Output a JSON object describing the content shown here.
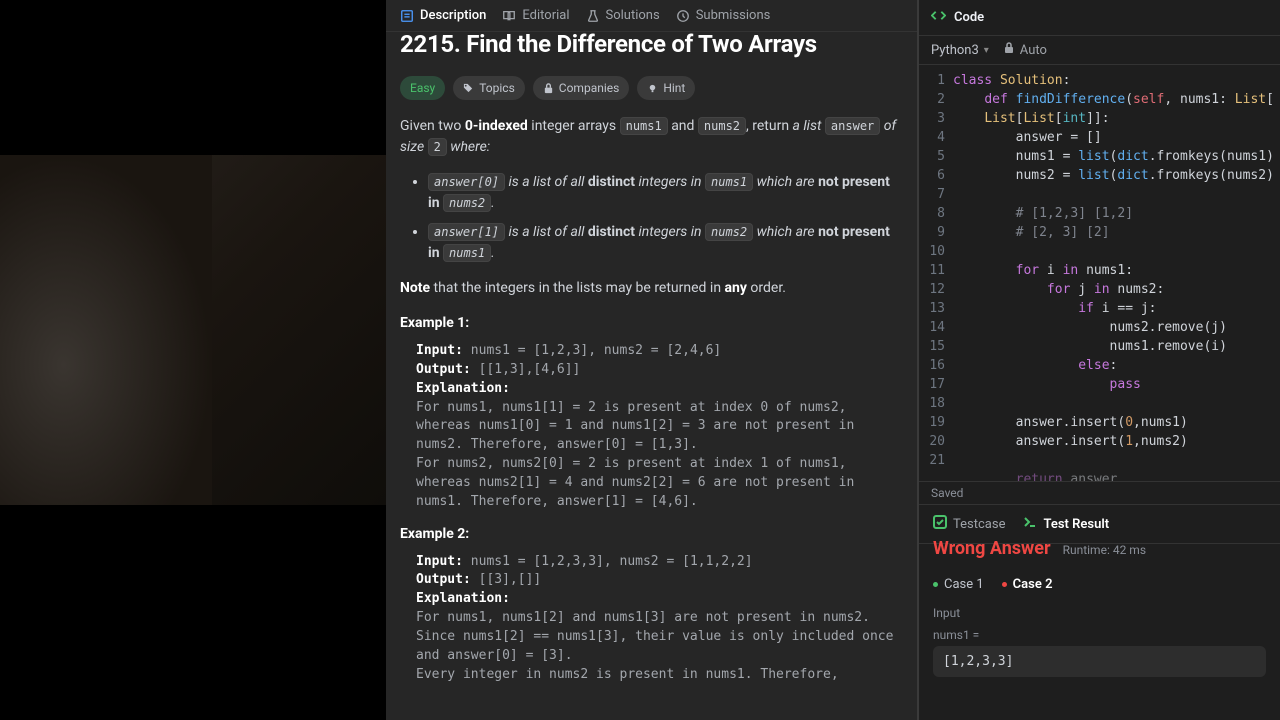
{
  "tabs": {
    "description": "Description",
    "editorial": "Editorial",
    "solutions": "Solutions",
    "submissions": "Submissions"
  },
  "problem": {
    "title": "2215. Find the Difference of Two Arrays",
    "difficulty": "Easy",
    "tag_topics": "Topics",
    "tag_companies": "Companies",
    "tag_hint": "Hint",
    "intro_pre": "Given two ",
    "intro_bold1": "0-indexed",
    "intro_mid1": " integer arrays ",
    "intro_code1": "nums1",
    "intro_and": " and ",
    "intro_code2": "nums2",
    "intro_mid2": ", return ",
    "intro_em1": "a list",
    "intro_code3": "answer",
    "intro_em2": " of size ",
    "intro_code4": "2",
    "intro_em3": " where:",
    "b0_code": "answer[0]",
    "b0_t1": " is a list of all ",
    "b0_bold": "distinct",
    "b0_t2": " integers in ",
    "b0_code2": "nums1",
    "b0_t3": " which are ",
    "b0_bold2": "not present in",
    "b0_code3": "nums2",
    "b0_t4": ".",
    "b1_code": "answer[1]",
    "b1_t1": " is a list of all ",
    "b1_bold": "distinct",
    "b1_t2": " integers in ",
    "b1_code2": "nums2",
    "b1_t3": " which are ",
    "b1_bold2": "not present in",
    "b1_code3": "nums1",
    "b1_t4": ".",
    "note_bold": "Note",
    "note_t1": " that the integers in the lists may be returned in ",
    "note_bold2": "any",
    "note_t2": " order.",
    "ex1_heading": "Example 1:",
    "ex1_input_lbl": "Input:",
    "ex1_input": " nums1 = [1,2,3], nums2 = [2,4,6]",
    "ex1_output_lbl": "Output:",
    "ex1_output": " [[1,3],[4,6]]",
    "ex1_expl_lbl": "Explanation:",
    "ex1_expl": "For nums1, nums1[1] = 2 is present at index 0 of nums2, whereas nums1[0] = 1 and nums1[2] = 3 are not present in nums2. Therefore, answer[0] = [1,3].\nFor nums2, nums2[0] = 2 is present at index 1 of nums1, whereas nums2[1] = 4 and nums2[2] = 6 are not present in nums1. Therefore, answer[1] = [4,6].",
    "ex2_heading": "Example 2:",
    "ex2_input_lbl": "Input:",
    "ex2_input": " nums1 = [1,2,3,3], nums2 = [1,1,2,2]",
    "ex2_output_lbl": "Output:",
    "ex2_output": " [[3],[]]",
    "ex2_expl_lbl": "Explanation:",
    "ex2_expl": "For nums1, nums1[2] and nums1[3] are not present in nums2. Since nums1[2] == nums1[3], their value is only included once and answer[0] = [3].\nEvery integer in nums2 is present in nums1. Therefore,"
  },
  "code": {
    "header": "Code",
    "language": "Python3",
    "auto": "Auto",
    "saved": "Saved",
    "line_numbers": [
      "1",
      "2",
      " ",
      "3",
      "4",
      "5",
      "6",
      "7",
      "8",
      "9",
      "10",
      "11",
      "12",
      "13",
      "14",
      "15",
      "16",
      "17",
      "18",
      "19",
      "20",
      "21"
    ]
  },
  "testcase_tabs": {
    "testcase": "Testcase",
    "test_result": "Test Result"
  },
  "result": {
    "status": "Wrong Answer",
    "runtime": "Runtime: 42 ms",
    "case1": "Case 1",
    "case2": "Case 2",
    "input_label": "Input",
    "nums1_label": "nums1 =",
    "nums1_value": "[1,2,3,3]"
  }
}
